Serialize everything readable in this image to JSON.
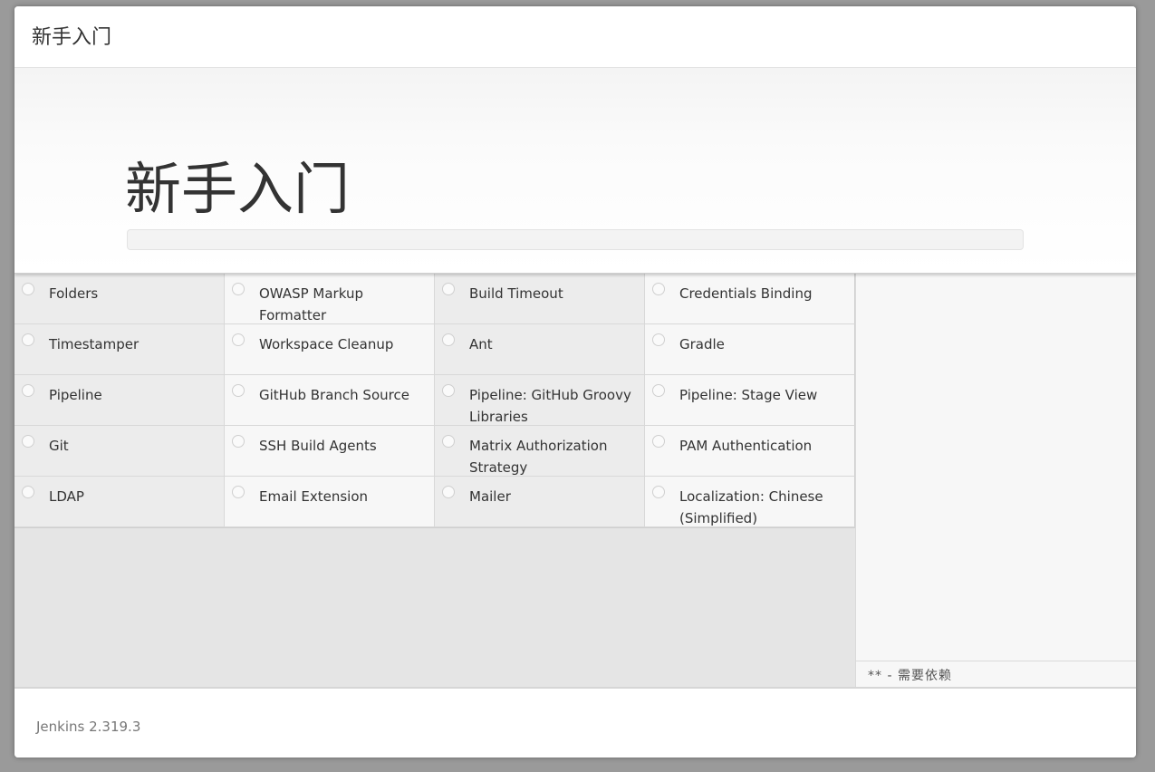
{
  "header": {
    "title": "新手入门"
  },
  "hero": {
    "title": "新手入门",
    "progress": 0
  },
  "plugins": [
    {
      "label": "Folders"
    },
    {
      "label": "OWASP Markup Formatter"
    },
    {
      "label": "Build Timeout"
    },
    {
      "label": "Credentials Binding"
    },
    {
      "label": "Timestamper"
    },
    {
      "label": "Workspace Cleanup"
    },
    {
      "label": "Ant"
    },
    {
      "label": "Gradle"
    },
    {
      "label": "Pipeline"
    },
    {
      "label": "GitHub Branch Source"
    },
    {
      "label": "Pipeline: GitHub Groovy Libraries"
    },
    {
      "label": "Pipeline: Stage View"
    },
    {
      "label": "Git"
    },
    {
      "label": "SSH Build Agents"
    },
    {
      "label": "Matrix Authorization Strategy"
    },
    {
      "label": "PAM Authentication"
    },
    {
      "label": "LDAP"
    },
    {
      "label": "Email Extension"
    },
    {
      "label": "Mailer"
    },
    {
      "label": "Localization: Chinese (Simplified)"
    }
  ],
  "side_panel": {
    "footnote": "** - 需要依赖"
  },
  "footer": {
    "version": "Jenkins 2.319.3"
  },
  "colors": {
    "background": "#9a9a9a",
    "shade_cell": "#ececec",
    "light_cell": "#f7f7f7"
  }
}
